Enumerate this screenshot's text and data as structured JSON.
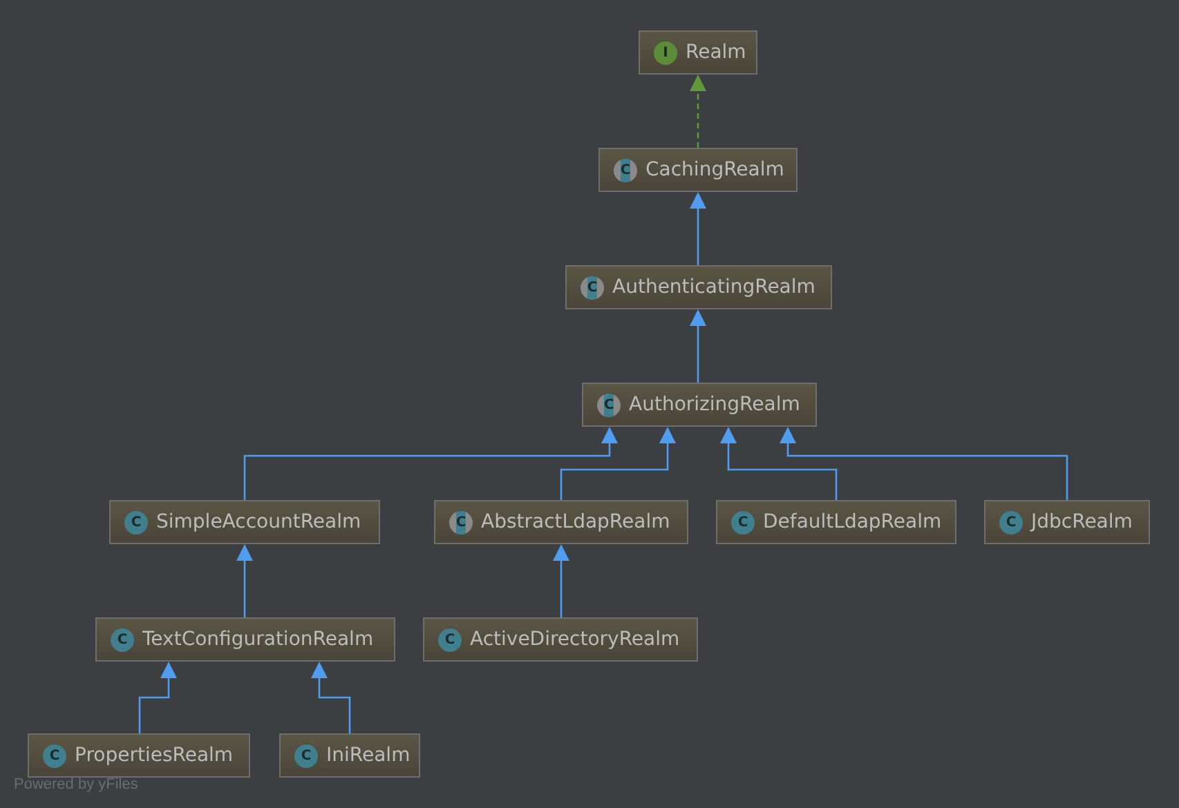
{
  "diagram": {
    "root": {
      "name": "Realm",
      "kind": "interface",
      "badge": "I",
      "children": [
        {
          "name": "CachingRealm",
          "kind": "abstract",
          "badge": "C",
          "implements": true,
          "children": [
            {
              "name": "AuthenticatingRealm",
              "kind": "abstract",
              "badge": "C",
              "implements": false,
              "children": [
                {
                  "name": "AuthorizingRealm",
                  "kind": "abstract",
                  "badge": "C",
                  "implements": false,
                  "children": [
                    {
                      "name": "SimpleAccountRealm",
                      "kind": "class",
                      "badge": "C",
                      "implements": false,
                      "children": [
                        {
                          "name": "TextConfigurationRealm",
                          "kind": "class",
                          "badge": "C",
                          "implements": false,
                          "children": [
                            {
                              "name": "PropertiesRealm",
                              "kind": "class",
                              "badge": "C",
                              "implements": false
                            },
                            {
                              "name": "IniRealm",
                              "kind": "class",
                              "badge": "C",
                              "implements": false
                            }
                          ]
                        }
                      ]
                    },
                    {
                      "name": "AbstractLdapRealm",
                      "kind": "abstract",
                      "badge": "C",
                      "implements": false,
                      "children": [
                        {
                          "name": "ActiveDirectoryRealm",
                          "kind": "class",
                          "badge": "C",
                          "implements": false
                        }
                      ]
                    },
                    {
                      "name": "DefaultLdapRealm",
                      "kind": "class",
                      "badge": "C",
                      "implements": false
                    },
                    {
                      "name": "JdbcRealm",
                      "kind": "class",
                      "badge": "C",
                      "implements": false
                    }
                  ]
                }
              ]
            }
          ]
        }
      ]
    },
    "footer": "Powered by yFiles"
  }
}
